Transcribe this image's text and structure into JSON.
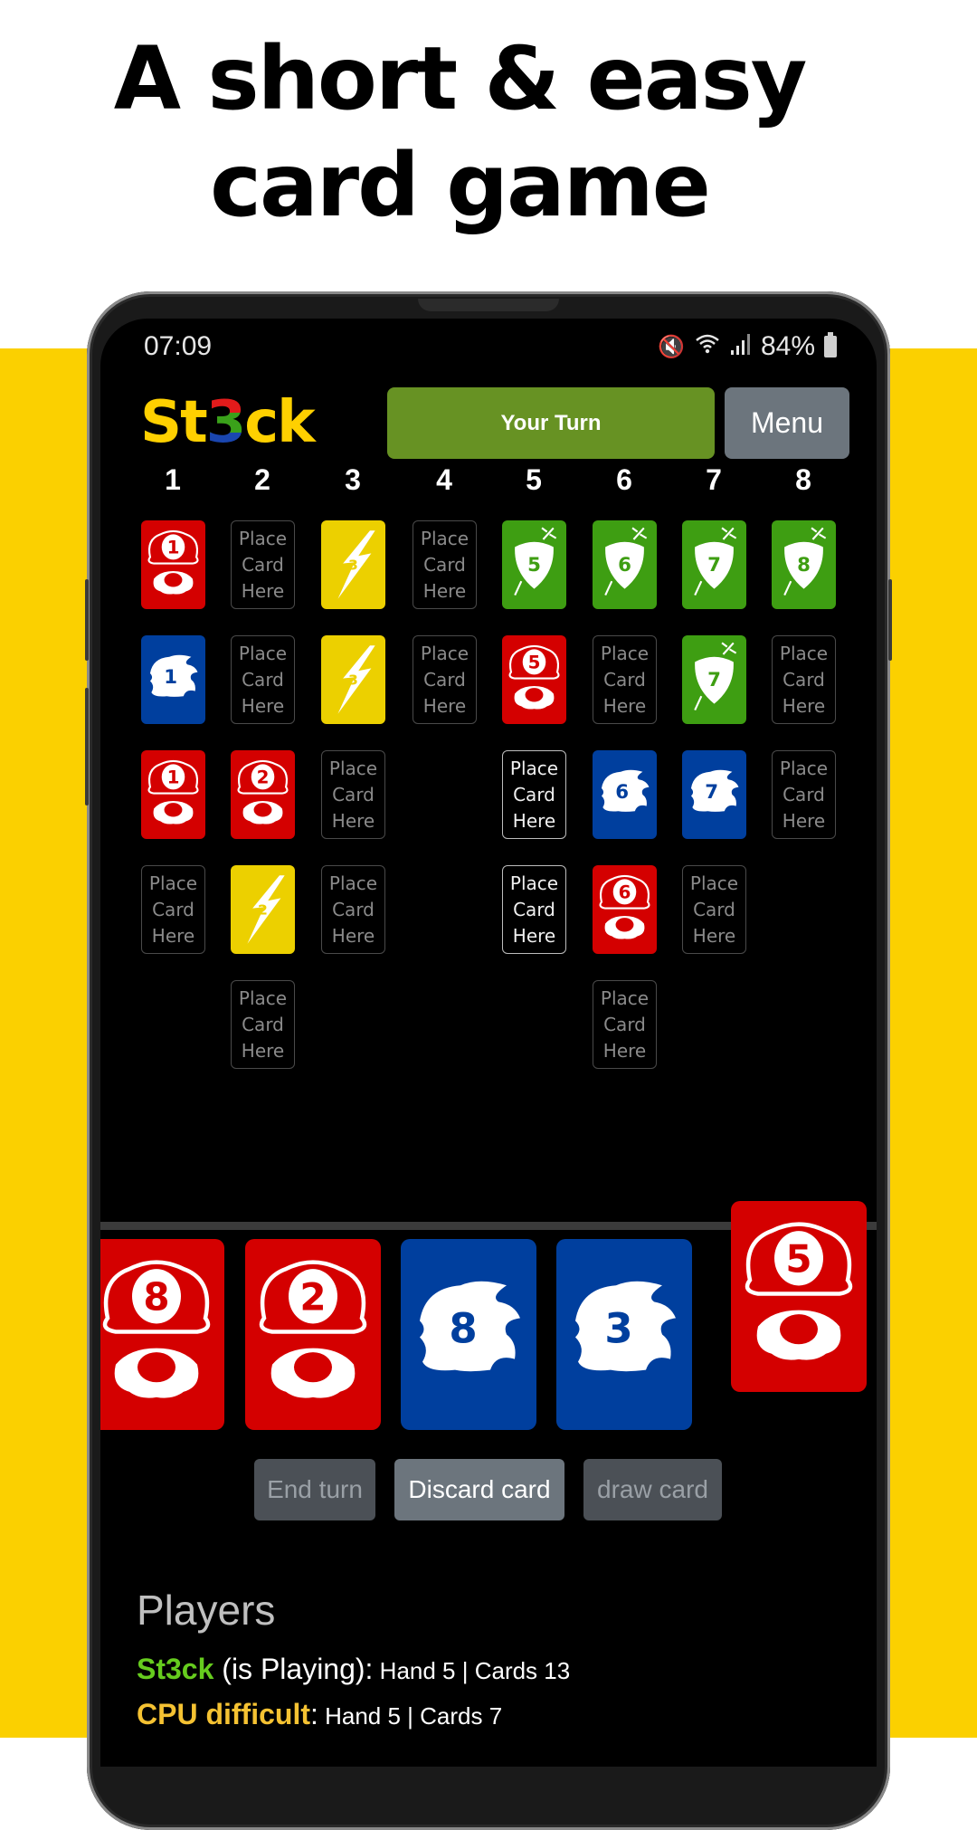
{
  "headline": {
    "line1": "A short & easy",
    "line2": "card game"
  },
  "status_bar": {
    "time": "07:09",
    "icons": [
      "mute-vibrate-icon",
      "wifi-icon",
      "signal-icon"
    ],
    "battery": "84%"
  },
  "app": {
    "logo": {
      "prefix": "St",
      "three": "3",
      "suffix": "ck"
    },
    "turn_label": "Your Turn",
    "menu_label": "Menu"
  },
  "colors": {
    "red": "#d40000",
    "blue": "#003f9e",
    "yellow": "#ecd000",
    "green": "#3e9e12",
    "turn_green": "#679223",
    "menu_gray": "#6c757d",
    "player_green": "#66cc1e",
    "cpu_yellow": "#f5c232",
    "page_yellow": "#fbd000"
  },
  "board": {
    "columns": [
      "1",
      "2",
      "3",
      "4",
      "5",
      "6",
      "7",
      "8"
    ],
    "placeholder_text": [
      "Place",
      "Card",
      "Here"
    ],
    "stacks": [
      [
        {
          "suit": "red",
          "value": "1"
        },
        {
          "suit": "blue",
          "value": "1"
        },
        {
          "suit": "red",
          "value": "1"
        },
        {
          "suit": "empty"
        }
      ],
      [
        {
          "suit": "empty"
        },
        {
          "suit": "empty"
        },
        {
          "suit": "red",
          "value": "2"
        },
        {
          "suit": "yellow",
          "value": "2"
        },
        {
          "suit": "empty"
        }
      ],
      [
        {
          "suit": "yellow",
          "value": "3"
        },
        {
          "suit": "yellow",
          "value": "3"
        },
        {
          "suit": "empty"
        },
        {
          "suit": "empty"
        }
      ],
      [
        {
          "suit": "empty"
        },
        {
          "suit": "empty"
        }
      ],
      [
        {
          "suit": "green",
          "value": "5"
        },
        {
          "suit": "red",
          "value": "5"
        },
        {
          "suit": "empty",
          "highlight": true
        },
        {
          "suit": "empty",
          "highlight": true
        }
      ],
      [
        {
          "suit": "green",
          "value": "6"
        },
        {
          "suit": "empty"
        },
        {
          "suit": "blue",
          "value": "6"
        },
        {
          "suit": "red",
          "value": "6"
        },
        {
          "suit": "empty"
        }
      ],
      [
        {
          "suit": "green",
          "value": "7"
        },
        {
          "suit": "green",
          "value": "7"
        },
        {
          "suit": "blue",
          "value": "7"
        },
        {
          "suit": "empty"
        }
      ],
      [
        {
          "suit": "green",
          "value": "8"
        },
        {
          "suit": "empty"
        },
        {
          "suit": "empty"
        }
      ]
    ]
  },
  "hand": [
    {
      "suit": "red",
      "value": "8"
    },
    {
      "suit": "red",
      "value": "2"
    },
    {
      "suit": "blue",
      "value": "8"
    },
    {
      "suit": "blue",
      "value": "3"
    },
    {
      "suit": "red",
      "value": "5",
      "selected": true
    }
  ],
  "actions": {
    "end_turn": "End turn",
    "discard": "Discard card",
    "draw": "draw card"
  },
  "players": {
    "title": "Players",
    "list": [
      {
        "name": "St3ck",
        "status": " (is Playing):",
        "stats": " Hand 5 | Cards 13"
      },
      {
        "name": "CPU difficult",
        "status": ":",
        "stats": " Hand 5 | Cards 7"
      }
    ]
  }
}
